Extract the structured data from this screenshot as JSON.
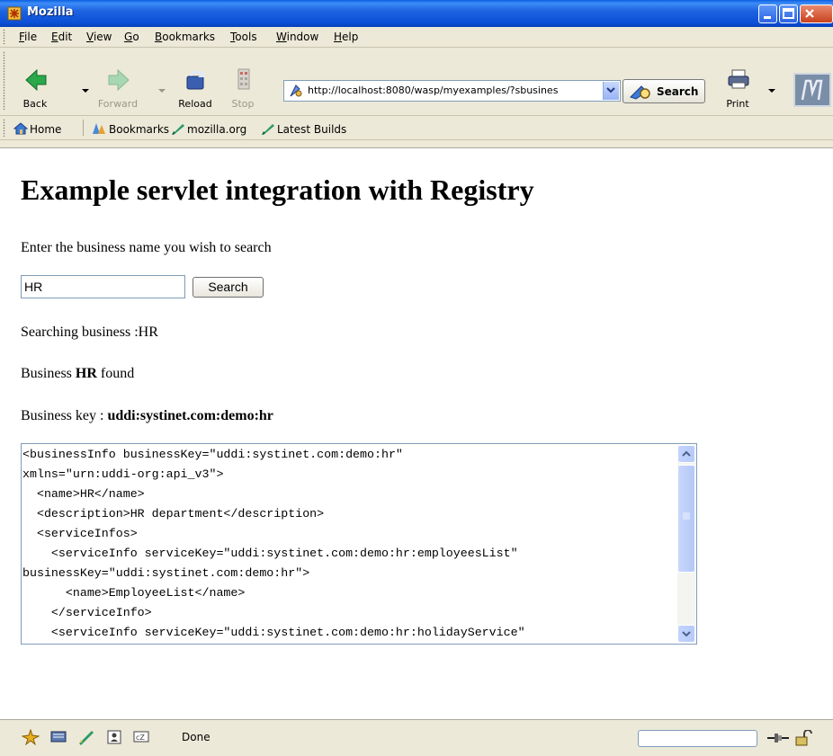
{
  "window": {
    "title": "Mozilla"
  },
  "menu": {
    "items": [
      {
        "label": "File",
        "key": "F"
      },
      {
        "label": "Edit",
        "key": "E"
      },
      {
        "label": "View",
        "key": "V"
      },
      {
        "label": "Go",
        "key": "G"
      },
      {
        "label": "Bookmarks",
        "key": "B"
      },
      {
        "label": "Tools",
        "key": "T"
      },
      {
        "label": "Window",
        "key": "W"
      },
      {
        "label": "Help",
        "key": "H"
      }
    ]
  },
  "nav": {
    "back_label": "Back",
    "forward_label": "Forward",
    "reload_label": "Reload",
    "stop_label": "Stop",
    "print_label": "Print",
    "url": "http://localhost:8080/wasp/myexamples/?sbusines",
    "search_label": "Search"
  },
  "personal": {
    "home_label": "Home",
    "bookmarks_label": "Bookmarks",
    "mozilla_label": "mozilla.org",
    "builds_label": "Latest Builds"
  },
  "page": {
    "heading": "Example servlet integration with Registry",
    "prompt": "Enter the business name you wish to search",
    "query_value": "HR",
    "search_button": "Search",
    "searching_prefix": "Searching business :",
    "searching_name": "HR",
    "found_prefix": "Business ",
    "found_name": "HR",
    "found_suffix": " found",
    "key_prefix": "Business key : ",
    "key_value": "uddi:systinet.com:demo:hr",
    "xml_text": "<businessInfo businessKey=\"uddi:systinet.com:demo:hr\"\nxmlns=\"urn:uddi-org:api_v3\">\n  <name>HR</name>\n  <description>HR department</description>\n  <serviceInfos>\n    <serviceInfo serviceKey=\"uddi:systinet.com:demo:hr:employeesList\"\nbusinessKey=\"uddi:systinet.com:demo:hr\">\n      <name>EmployeeList</name>\n    </serviceInfo>\n    <serviceInfo serviceKey=\"uddi:systinet.com:demo:hr:holidayService\"\nbusinessKey=\"uddi:systinet.com:demo:hr\">"
  },
  "status": {
    "text": "Done"
  }
}
